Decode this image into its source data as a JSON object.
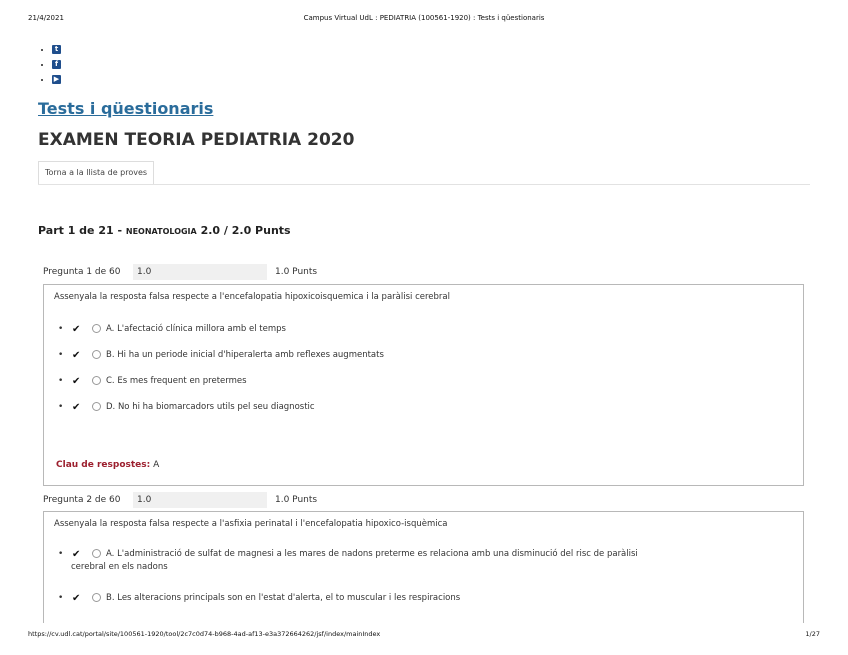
{
  "header": {
    "date": "21/4/2021",
    "title": "Campus Virtual UdL : PEDIATRIA (100561-1920) : Tests i qüestionaris"
  },
  "social": [
    "twitter-icon",
    "facebook-icon",
    "youtube-icon"
  ],
  "breadcrumb": "Tests i qüestionaris",
  "exam_title": "EXAMEN TEORIA PEDIATRIA 2020",
  "back_tab": "Torna a la llista de proves",
  "part": {
    "label": "Part 1 de 21 - ",
    "section": "NEONATOLOGIA",
    "score": "2.0 / 2.0 Punts"
  },
  "questions": [
    {
      "label": "Pregunta 1 de 60",
      "score": "1.0",
      "points": "1.0 Punts",
      "text": "Assenyala la resposta falsa respecte a l'encefalopatia hipoxicoisquemica i la paràlisi cerebral",
      "options": [
        "A. L'afectació clínica millora amb el temps",
        "B. Hi ha un periode inicial d'hiperalerta amb reflexes augmentats",
        "C. Es mes frequent en pretermes",
        "D. No hi ha biomarcadors utils pel seu diagnostic"
      ],
      "key_label": "Clau de respostes:",
      "key_value": " A"
    },
    {
      "label": "Pregunta 2 de 60",
      "score": "1.0",
      "points": "1.0 Punts",
      "text": "Assenyala la resposta falsa respecte a l'asfixia perinatal i l'encefalopatia hipoxico-isquèmica",
      "options": [
        "A. L'administració de sulfat de magnesi a les mares de nadons preterme es relaciona amb una disminució del risc de paràlisi",
        "cerebral en els nadons",
        "B. Les alteracions principals son en l'estat d'alerta, el to muscular i les respiracions"
      ]
    }
  ],
  "footer": {
    "url": "https://cv.udl.cat/portal/site/100561-1920/tool/2c7c0d74-b968-4ad-af13-e3a372664262/jsf/index/mainIndex",
    "page": "1/27"
  }
}
